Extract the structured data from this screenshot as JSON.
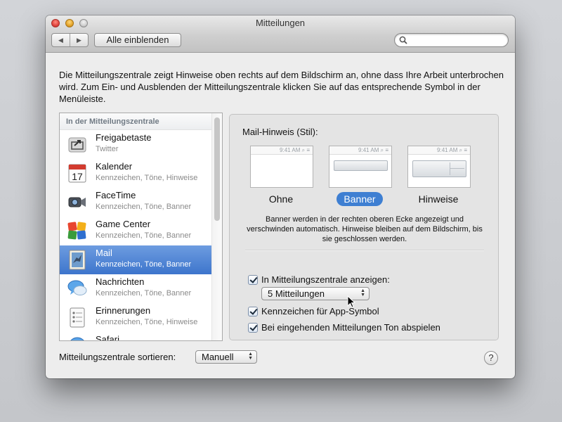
{
  "window": {
    "title": "Mitteilungen",
    "show_all_label": "Alle einblenden",
    "nav_back": "◀",
    "nav_forward": "▶",
    "search_placeholder": ""
  },
  "description": "Die Mitteilungszentrale zeigt Hinweise oben rechts auf dem Bildschirm an, ohne dass Ihre Arbeit unterbrochen wird. Zum Ein- und Ausblenden der Mitteilungszentrale klicken Sie auf das entsprechende Symbol in der Menüleiste.",
  "list": {
    "header": "In der Mitteilungszentrale",
    "items": [
      {
        "name": "Freigabetaste",
        "sub": "Twitter",
        "icon": "share-icon"
      },
      {
        "name": "Kalender",
        "sub": "Kennzeichen, Töne, Hinweise",
        "icon": "calendar-icon",
        "icon_text": "17"
      },
      {
        "name": "FaceTime",
        "sub": "Kennzeichen, Töne, Banner",
        "icon": "facetime-icon"
      },
      {
        "name": "Game Center",
        "sub": "Kennzeichen, Töne, Banner",
        "icon": "game-center-icon"
      },
      {
        "name": "Mail",
        "sub": "Kennzeichen, Töne, Banner",
        "icon": "mail-icon",
        "selected": true
      },
      {
        "name": "Nachrichten",
        "sub": "Kennzeichen, Töne, Banner",
        "icon": "messages-icon"
      },
      {
        "name": "Erinnerungen",
        "sub": "Kennzeichen, Töne, Hinweise",
        "icon": "reminders-icon"
      },
      {
        "name": "Safari",
        "sub": "",
        "icon": "safari-icon"
      }
    ]
  },
  "detail": {
    "style_label": "Mail-Hinweis (Stil):",
    "preview_time": "9:41 AM",
    "styles": [
      {
        "label": "Ohne",
        "selected": false
      },
      {
        "label": "Banner",
        "selected": true
      },
      {
        "label": "Hinweise",
        "selected": false
      }
    ],
    "style_description": "Banner werden in der rechten oberen Ecke angezeigt und verschwinden automatisch. Hinweise bleiben auf dem Bildschirm, bis sie geschlossen werden.",
    "show_in_center_label": "In Mitteilungszentrale anzeigen:",
    "show_in_center_checked": true,
    "count_value": "5 Mitteilungen",
    "badge_label": "Kennzeichen für App-Symbol",
    "badge_checked": true,
    "sound_label": "Bei eingehenden Mitteilungen Ton abspielen",
    "sound_checked": true
  },
  "sort": {
    "label": "Mitteilungszentrale sortieren:",
    "value": "Manuell"
  },
  "help_label": "?"
}
